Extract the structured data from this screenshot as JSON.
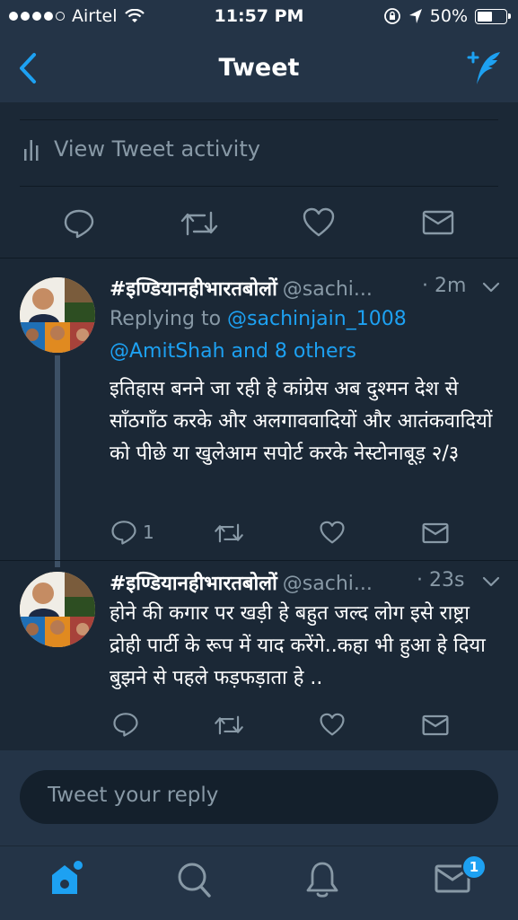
{
  "status_bar": {
    "carrier": "Airtel",
    "time": "11:57 PM",
    "battery": "50%"
  },
  "nav": {
    "title": "Tweet"
  },
  "activity": {
    "label": "View Tweet activity"
  },
  "tweets": [
    {
      "name": "#इण्डियानहीभारतबोलों",
      "handle": "@sachi...",
      "time": "· 2m",
      "replying_prefix": "Replying to",
      "replying_user": "@sachinjain_1008",
      "replying_others": "@AmitShah and 8 others",
      "text": "इतिहास बनने जा रही हे कांग्रेस अब दुश्मन देश से साँठगाँठ करके और अलगाववादियों और आतंकवादियों को पीछे या खुलेआम सपोर्ट करके नेस्टोनाबूड़ २/३",
      "reply_count": "1"
    },
    {
      "name": "#इण्डियानहीभारतबोलों",
      "handle": "@sachi...",
      "time": "· 23s",
      "text": "होने की कगार पर खड़ी हे बहुत जल्द लोग इसे राष्ट्रा द्रोही पार्टी के रूप में याद करेंगे..कहा भी हुआ हे दिया बुझने से पहले फड़फड़ाता हे .."
    }
  ],
  "reply_field": {
    "placeholder": "Tweet your reply"
  },
  "tab_bar": {
    "messages_badge": "1"
  },
  "colors": {
    "accent": "#1da1f2",
    "background": "#1b2836",
    "bar": "#243447",
    "muted": "#8899a6"
  }
}
